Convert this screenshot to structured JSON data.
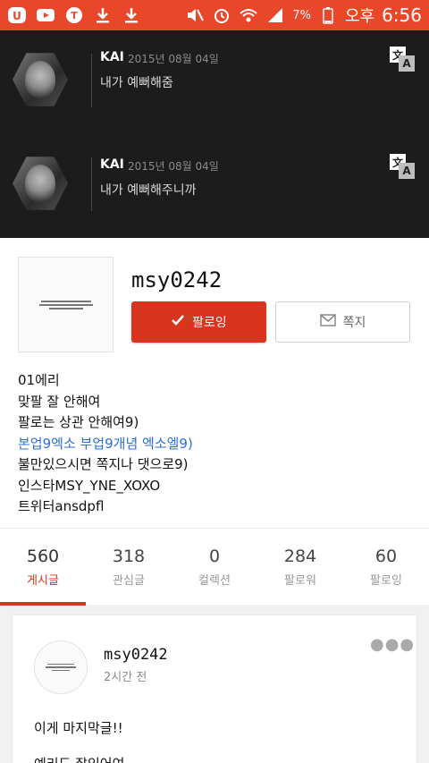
{
  "status_bar": {
    "battery": "7%",
    "ampm": "오후",
    "time": "6:56"
  },
  "dark_posts": [
    {
      "author": "KAI",
      "date": "2015년 08월 04일",
      "text": "내가 예뻐해줌"
    },
    {
      "author": "KAI",
      "date": "2015년 08월 04일",
      "text": "내가 예뻐해주니까"
    }
  ],
  "profile": {
    "username": "msy0242",
    "follow_label": "팔로잉",
    "message_label": "쪽지",
    "bio": [
      "01에리",
      "맞팔 잘 안해여",
      "팔로는 상관 안해여9)",
      "본업9엑소 부업9개념 엑소엘9)",
      "불만있으시면 쪽지나 댓으로9)",
      "인스타MSY_YNE_XOXO",
      "트위터ansdpfl"
    ]
  },
  "tabs": [
    {
      "count": "560",
      "label": "게시글"
    },
    {
      "count": "318",
      "label": "관심글"
    },
    {
      "count": "0",
      "label": "컬렉션"
    },
    {
      "count": "284",
      "label": "팔로워"
    },
    {
      "count": "60",
      "label": "팔로잉"
    }
  ],
  "post": {
    "username": "msy0242",
    "time": "2시간 전",
    "lines": [
      "이게 마지막글!!",
      "예리도 잘있어여"
    ]
  },
  "colors": {
    "accent": "#e8472a",
    "follow_button": "#d9341d",
    "link": "#2d6fd6"
  }
}
